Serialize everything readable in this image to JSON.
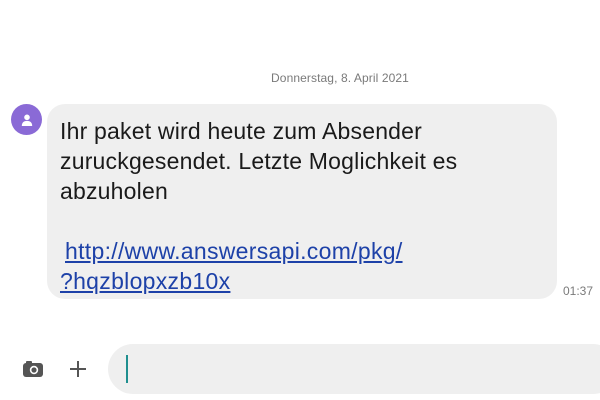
{
  "conversation": {
    "date_header": "Donnerstag, 8. April 2021",
    "message": {
      "text": "Ihr paket wird heute zum Absender zuruckgesendet. Letzte Moglichkeit es abzuholen",
      "link_line_1": "http://www.answersapi.com/pkg/",
      "link_line_2": "?hqzblopxzb10x",
      "time": "01:37",
      "sender_avatar_icon": "person-icon"
    }
  },
  "composer": {
    "camera_icon": "camera-icon",
    "add_icon": "plus-icon",
    "input_value": ""
  },
  "colors": {
    "avatar": "#8a6ad6",
    "bubble": "#efefef",
    "link": "#1d41a8",
    "caret": "#1f8f8f"
  }
}
